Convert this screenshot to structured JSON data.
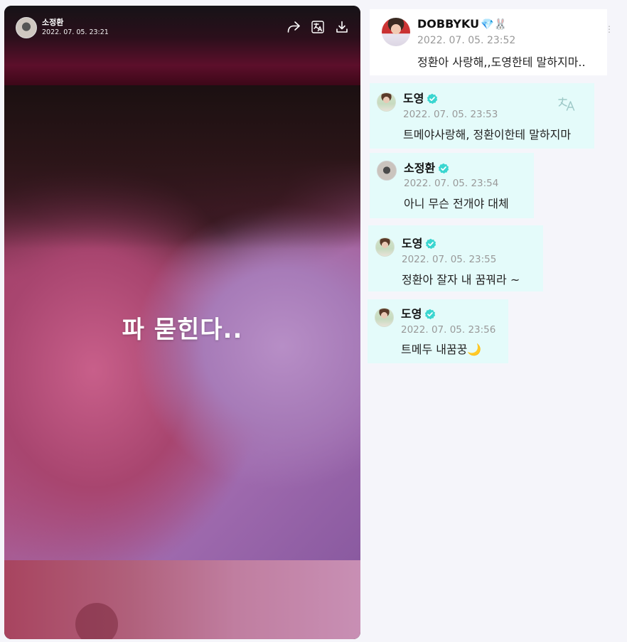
{
  "story": {
    "username": "소정환",
    "timestamp": "2022. 07. 05. 23:21",
    "caption": "파 묻힌다.."
  },
  "post": {
    "username": "DOBBYKU",
    "badges": "💎🐰",
    "timestamp": "2022. 07. 05. 23:52",
    "text": "정환아 사랑해,,도영한테 말하지마.."
  },
  "comments": [
    {
      "username": "도영",
      "timestamp": "2022. 07. 05. 23:53",
      "text": "트메야사랑해, 정환이한테 말하지마"
    },
    {
      "username": "소정환",
      "timestamp": "2022. 07. 05. 23:54",
      "text": "아니 무슨 전개야 대체"
    },
    {
      "username": "도영",
      "timestamp": "2022. 07. 05. 23:55",
      "text": "정환아 잘자 내 꿈꿔라 ~"
    },
    {
      "username": "도영",
      "timestamp": "2022. 07. 05. 23:56",
      "text": "트메두 내꿈꿍🌙"
    }
  ],
  "icons": {
    "share": "share-icon",
    "translate": "translate-icon",
    "download": "download-icon",
    "verified": "verified-badge-icon"
  },
  "colors": {
    "comment_bg": "#e4fbfa",
    "verified": "#3ad6d0",
    "page_bg": "#f5f5fa"
  }
}
